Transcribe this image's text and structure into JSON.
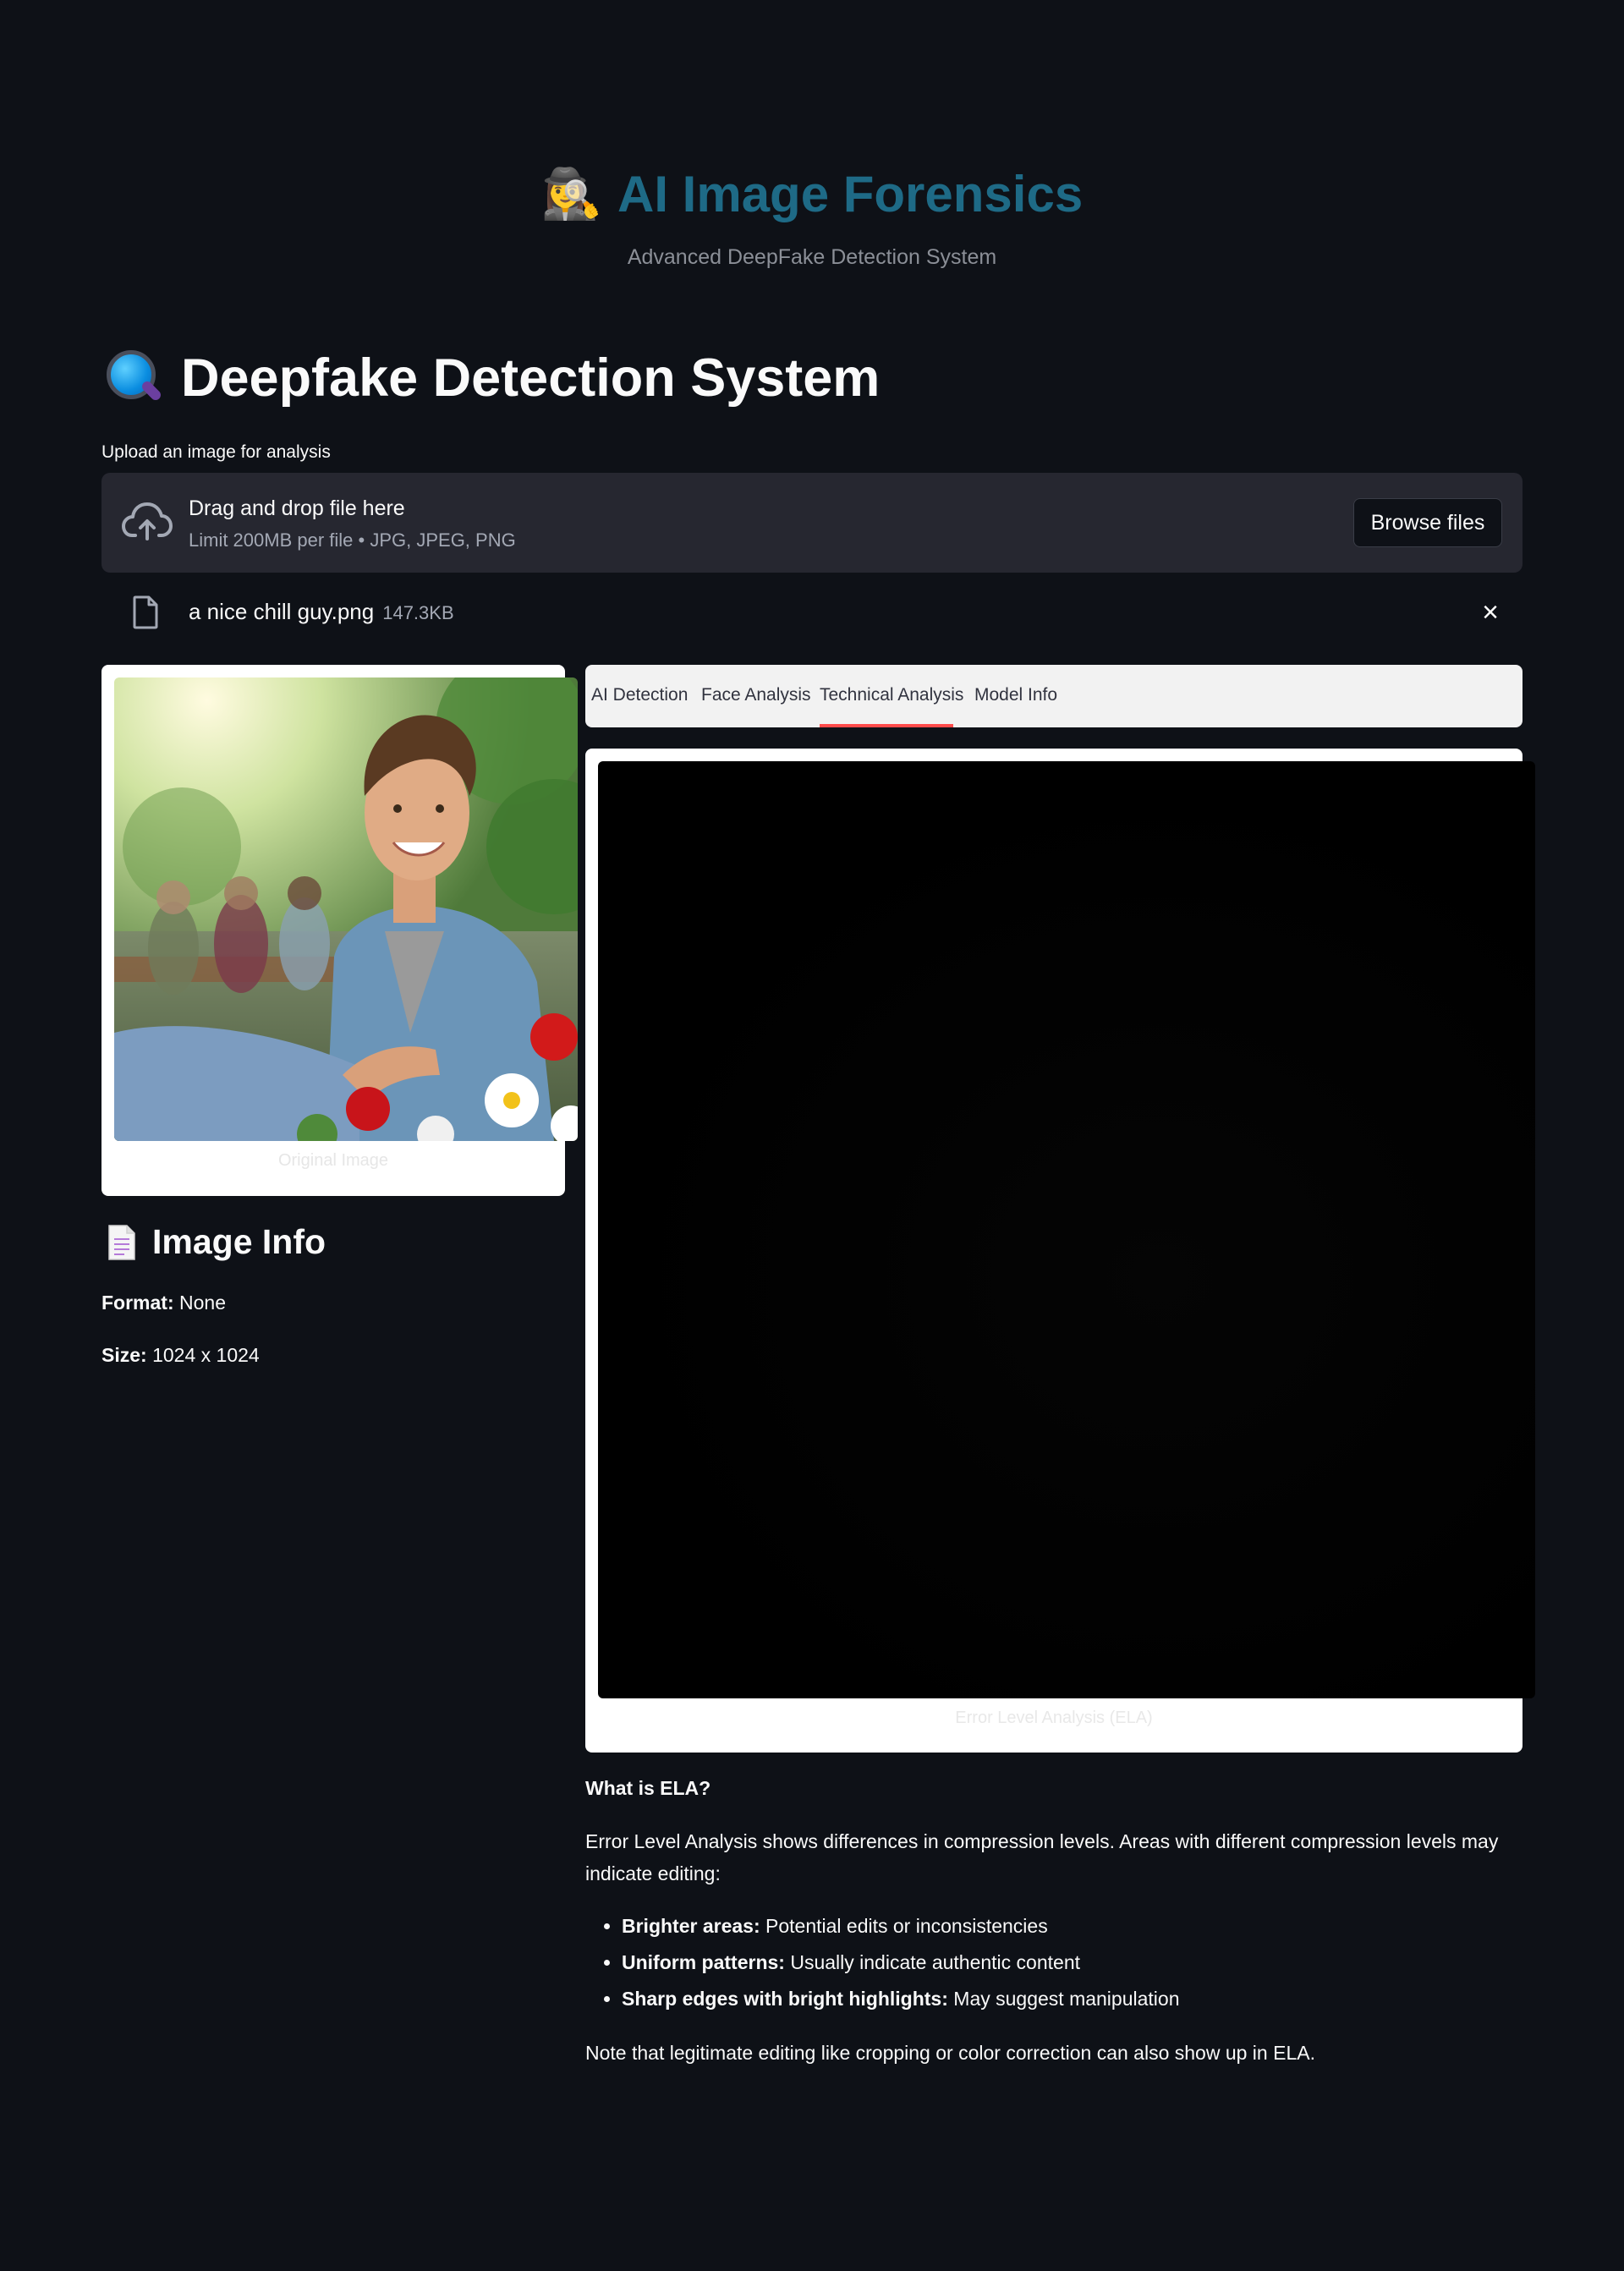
{
  "header": {
    "emoji": "🕵️‍♀️",
    "title": "AI Image Forensics",
    "subtitle": "Advanced DeepFake Detection System"
  },
  "page_title": "Deepfake Detection System",
  "uploader": {
    "label": "Upload an image for analysis",
    "drop_text": "Drag and drop file here",
    "limit_text": "Limit 200MB per file • JPG, JPEG, PNG",
    "browse_label": "Browse files"
  },
  "file": {
    "name": "a nice chill guy.png",
    "size": "147.3KB",
    "close_symbol": "×"
  },
  "left": {
    "image_caption": "Original Image",
    "info_title": "Image Info",
    "format_label": "Format:",
    "format_value": "None",
    "size_label": "Size:",
    "size_value": "1024 x 1024"
  },
  "tabs": [
    {
      "label": "AI Detection"
    },
    {
      "label": "Face Analysis"
    },
    {
      "label": "Technical Analysis",
      "active": true
    },
    {
      "label": "Model Info"
    }
  ],
  "ela": {
    "caption": "Error Level Analysis (ELA)",
    "heading": "What is ELA?",
    "intro": "Error Level Analysis shows differences in compression levels. Areas with different compression levels may indicate editing:",
    "bullets": [
      {
        "term": "Brighter areas:",
        "desc": "Potential edits or inconsistencies"
      },
      {
        "term": "Uniform patterns:",
        "desc": "Usually indicate authentic content"
      },
      {
        "term": "Sharp edges with bright highlights:",
        "desc": "May suggest manipulation"
      }
    ],
    "note": "Note that legitimate editing like cropping or color correction can also show up in ELA."
  },
  "colors": {
    "background": "#0e1117",
    "title_accent": "#1e6a86",
    "tab_active_underline": "#ff4b4b",
    "dropzone": "#262730"
  },
  "icons": [
    "detective-icon",
    "magnifying-glass-icon",
    "cloud-upload-icon",
    "file-icon",
    "close-icon",
    "document-icon"
  ]
}
